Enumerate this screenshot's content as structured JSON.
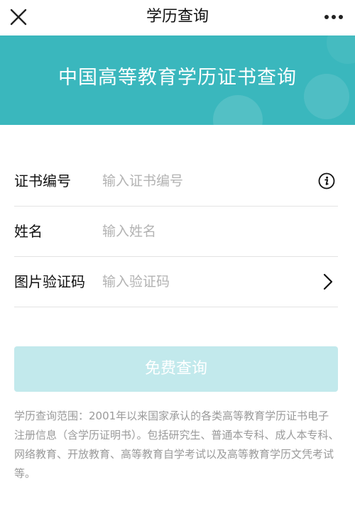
{
  "nav": {
    "title": "学历查询",
    "close_icon": "close-icon",
    "more_icon": "more-icon"
  },
  "banner": {
    "title": "中国高等教育学历证书查询",
    "background_color": "#3ab7bd"
  },
  "form": {
    "certificate_number": {
      "label": "证书编号",
      "placeholder": "输入证书编号",
      "value": "",
      "icon": "info-icon"
    },
    "name": {
      "label": "姓名",
      "placeholder": "输入姓名",
      "value": ""
    },
    "captcha": {
      "label": "图片验证码",
      "placeholder": "输入验证码",
      "value": "",
      "icon": "chevron-right-icon"
    }
  },
  "submit": {
    "label": "免费查询",
    "color": "#c2e9ec"
  },
  "note": "学历查询范围：2001年以来国家承认的各类高等教育学历证书电子注册信息（含学历证明书）。包括研究生、普通本专科、成人本专科、网络教育、开放教育、高等教育自学考试以及高等教育学历文凭考试等。"
}
